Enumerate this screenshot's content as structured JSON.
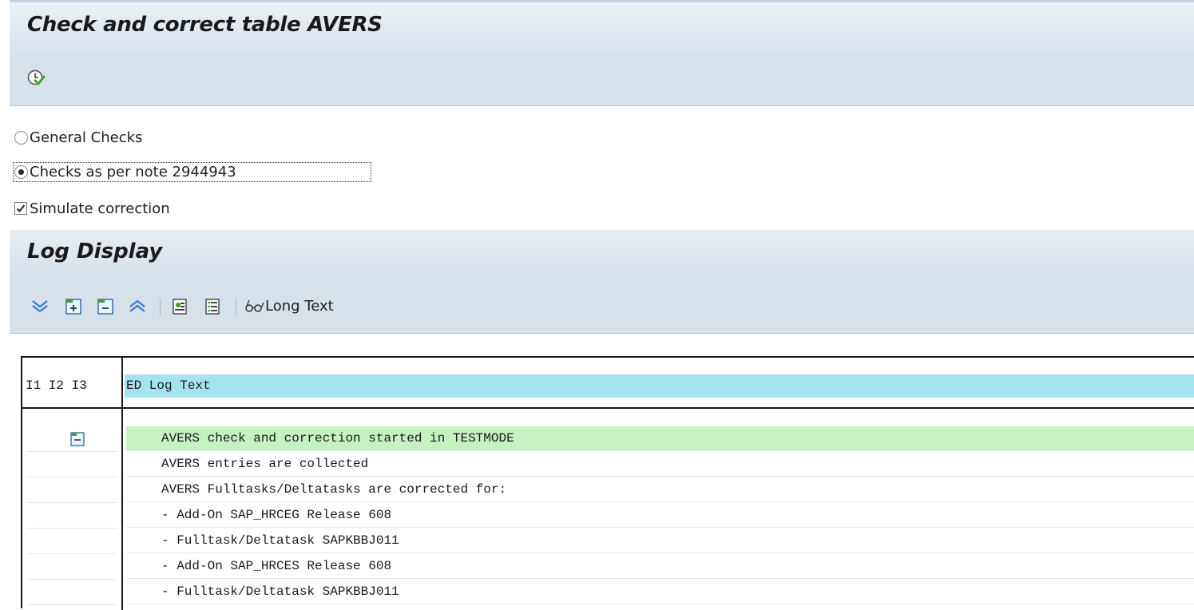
{
  "window": {
    "title": "Check and correct table AVERS"
  },
  "toolbar": {
    "execute_icon": "execute-clock-icon"
  },
  "options": {
    "general_checks": {
      "label": "General Checks",
      "selected": false
    },
    "note_checks": {
      "label": "Checks as per note 2944943",
      "selected": true
    },
    "simulate": {
      "label": "Simulate correction",
      "checked": true
    }
  },
  "log": {
    "title": "Log Display",
    "toolbar": {
      "buttons": [
        "expand-all-icon",
        "expand-subtree-icon",
        "collapse-subtree-icon",
        "collapse-all-icon",
        "detail-icon",
        "layout-icon"
      ],
      "long_text_label": "Long Text",
      "long_text_icon": "glasses-icon"
    },
    "columns": {
      "left": "I1 I2 I3",
      "right": "ED Log Text"
    },
    "rows": [
      {
        "text": "AVERS check and correction started in TESTMODE",
        "highlight": true,
        "icon": "folder-open-icon"
      },
      {
        "text": "AVERS entries are collected"
      },
      {
        "text": "AVERS Fulltasks/Deltatasks are corrected for:"
      },
      {
        "text": "- Add-On SAP_HRCEG Release 608"
      },
      {
        "text": "- Fulltask/Deltatask SAPKBBJ011"
      },
      {
        "text": "- Add-On SAP_HRCES Release 608"
      },
      {
        "text": "- Fulltask/Deltatask SAPKBBJ011"
      }
    ]
  },
  "colors": {
    "header_blue": "#a6e3f1",
    "highlight_green": "#c4f2c0",
    "toolbar_bg": "#d6e1ea"
  }
}
